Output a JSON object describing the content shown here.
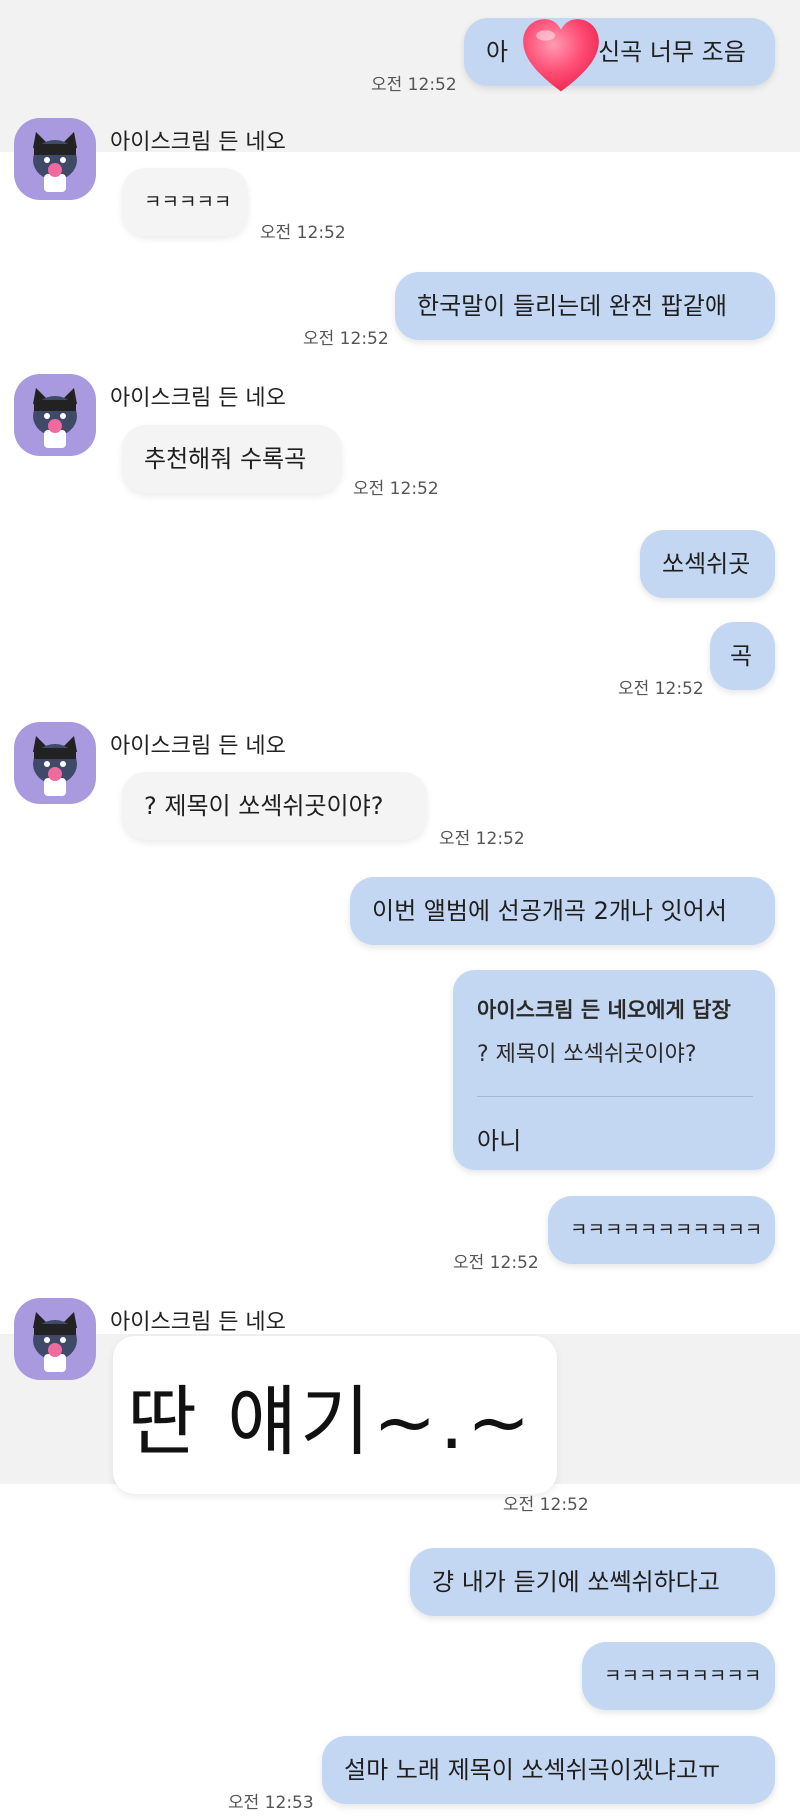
{
  "contact": {
    "name": "아이스크림 든 네오"
  },
  "colors": {
    "my_bubble": "#c4d7f2",
    "their_bubble": "#f4f4f4",
    "avatar_bg": "#a99ae0",
    "band": "#f2f2f2"
  },
  "icons": {
    "avatar": "neo-cat-avatar-icon",
    "sticker": "heart-sticker-icon"
  },
  "messages": {
    "m1": {
      "text": "아",
      "text_after": "신곡 너무 조음",
      "time": "오전 12:52"
    },
    "m2": {
      "text": "ㅋㅋㅋㅋㅋ",
      "time": "오전 12:52"
    },
    "m3": {
      "text": "한국말이 들리는데 완전 팝같애",
      "time": "오전 12:52"
    },
    "m4": {
      "text": "추천해줘 수록곡",
      "time": "오전 12:52"
    },
    "m5": {
      "text": "쏘섹쉬곳"
    },
    "m6": {
      "text": "곡",
      "time": "오전 12:52"
    },
    "m7": {
      "text": "? 제목이 쏘섹쉬곳이야?",
      "time": "오전 12:52"
    },
    "m8": {
      "text": "이번 앨범에 선공개곡 2개나 잇어서"
    },
    "m9": {
      "reply_title": "아이스크림 든 네오에게 답장",
      "quoted": "? 제목이 쏘섹쉬곳이야?",
      "text": "아니"
    },
    "m10": {
      "text": "ㅋㅋㅋㅋㅋㅋㅋㅋㅋㅋㅋ",
      "time": "오전 12:52"
    },
    "m11": {
      "text": "딴 얘기~.~",
      "time": "오전 12:52"
    },
    "m12": {
      "text": "걍 내가 듣기에 쏘쎅쉬하다고"
    },
    "m13": {
      "text": "ㅋㅋㅋㅋㅋㅋㅋㅋㅋ"
    },
    "m14": {
      "text": "설마 노래 제목이 쏘섹쉬곡이겠냐고ㅠ",
      "time": "오전 12:53"
    }
  }
}
